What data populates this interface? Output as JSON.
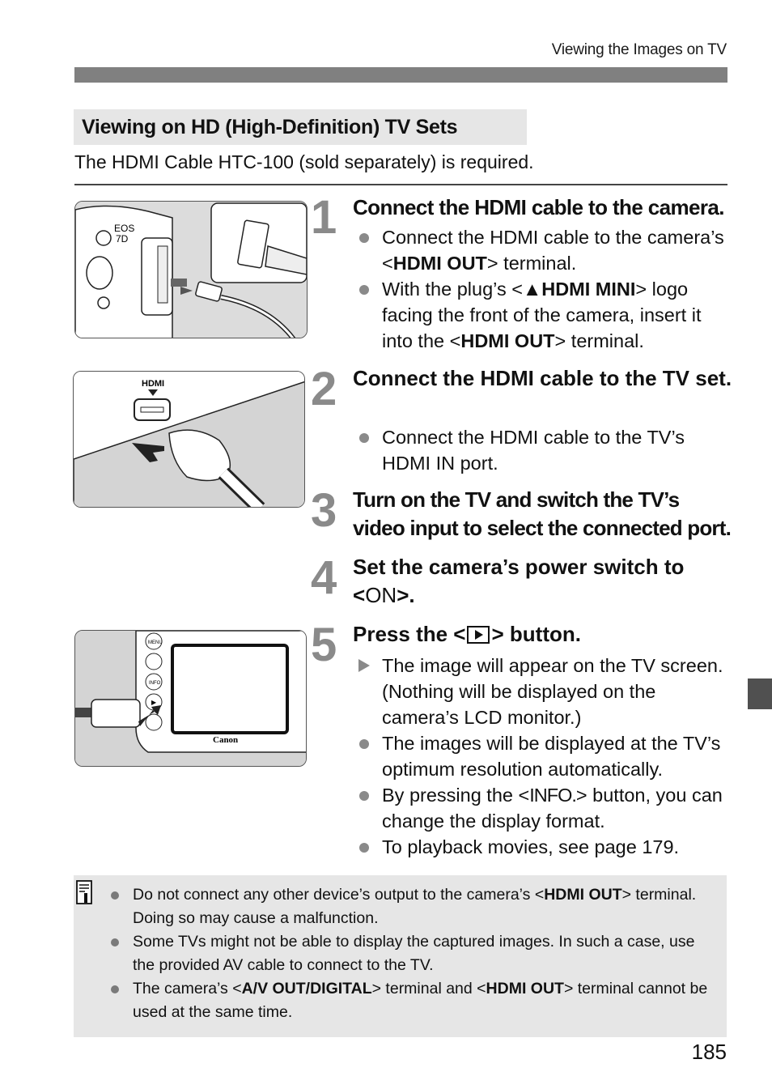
{
  "running_head": "Viewing the Images on TV",
  "section_title": "Viewing on HD (High-Definition) TV Sets",
  "intro": "The HDMI Cable HTC-100 (sold separately) is required.",
  "steps": [
    {
      "number": "1",
      "title": "Connect the HDMI cable to the camera.",
      "bullets": [
        {
          "type": "dot",
          "parts": [
            "Connect the HDMI cable to the camera’s <",
            "HDMI OUT",
            "> terminal."
          ]
        },
        {
          "type": "dot",
          "parts": [
            "With the plug’s <",
            "▲HDMI MINI",
            "> logo facing the front of the camera, insert it into the <",
            "HDMI OUT",
            "> terminal."
          ]
        }
      ]
    },
    {
      "number": "2",
      "title": "Connect the HDMI cable to the TV set.",
      "bullets": [
        {
          "type": "dot",
          "parts": [
            "Connect the HDMI cable to the TV’s HDMI IN port."
          ]
        }
      ]
    },
    {
      "number": "3",
      "title": "Turn on the TV and switch the TV’s video input to select the connected port.",
      "bullets": []
    },
    {
      "number": "4",
      "title_before": "Set the camera’s power switch to <",
      "title_mid": "ON",
      "title_after": ">.",
      "bullets": []
    },
    {
      "number": "5",
      "title_before": "Press the <",
      "title_after": "> button.",
      "bullets": [
        {
          "type": "arrow",
          "parts": [
            "The image will appear on the TV screen. (Nothing will be displayed on the camera’s LCD monitor.)"
          ]
        },
        {
          "type": "dot",
          "parts": [
            "The images will be displayed at the TV’s optimum resolution automatically."
          ]
        },
        {
          "type": "dot",
          "parts": [
            "By pressing the <",
            "INFO.",
            "> button, you can change the display format."
          ]
        },
        {
          "type": "dot",
          "parts": [
            "To playback movies, see page 179."
          ]
        }
      ]
    }
  ],
  "figures": {
    "fig1": {
      "model_label_1": "EOS",
      "model_label_2": "7D"
    },
    "fig2": {
      "port_label": "HDMI"
    },
    "fig3": {
      "brand": "Canon",
      "buttons": [
        "MENU",
        "",
        "INFO",
        "▶",
        ""
      ]
    }
  },
  "notes": [
    {
      "parts": [
        "Do not connect any other device’s output to the camera’s <",
        "HDMI OUT",
        "> terminal. Doing so may cause a malfunction."
      ]
    },
    {
      "parts": [
        "Some TVs might not be able to display the captured images. In such a case, use the provided AV cable to connect to the TV."
      ]
    },
    {
      "parts": [
        "The camera’s <",
        "A/V OUT/DIGITAL",
        "> terminal and <",
        "HDMI OUT",
        "> terminal cannot be used at the same time."
      ]
    }
  ],
  "page_number": "185"
}
